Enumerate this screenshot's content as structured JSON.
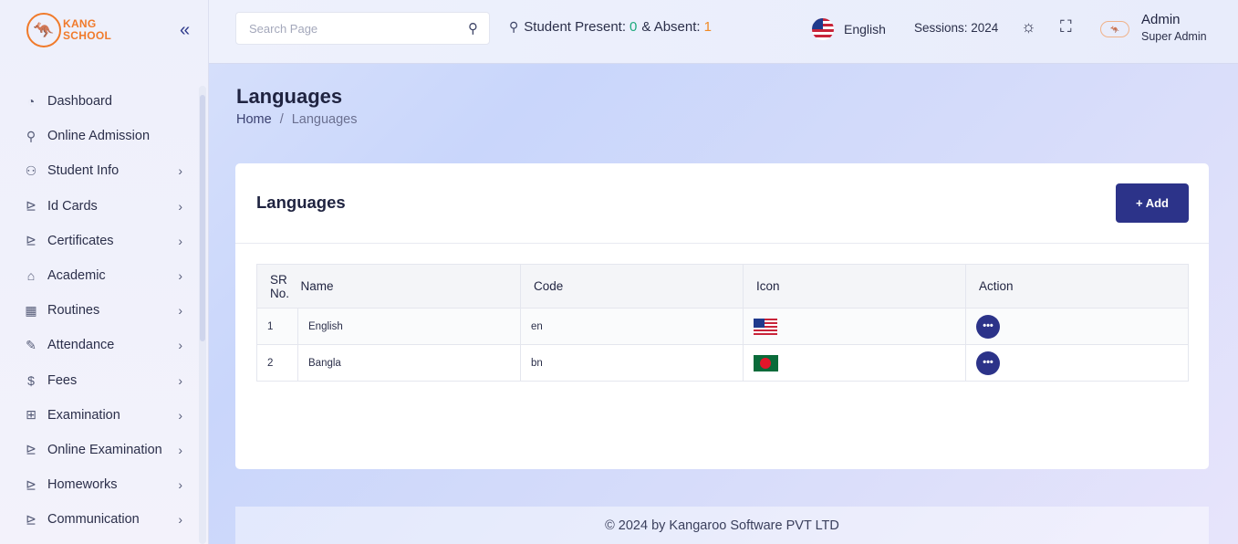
{
  "brand": {
    "logo_line1": "KANG",
    "logo_line2": "SCHOOL"
  },
  "sidebar": {
    "collapse_icon": "double-chevron-left-icon",
    "items": [
      {
        "label": "Dashboard",
        "icon": "gauge-icon",
        "has_children": false
      },
      {
        "label": "Online Admission",
        "icon": "user-icon",
        "has_children": false
      },
      {
        "label": "Student Info",
        "icon": "users-icon",
        "has_children": true
      },
      {
        "label": "Id Cards",
        "icon": "chart-icon",
        "has_children": true
      },
      {
        "label": "Certificates",
        "icon": "chart-icon",
        "has_children": true
      },
      {
        "label": "Academic",
        "icon": "graduation-cap-icon",
        "has_children": true
      },
      {
        "label": "Routines",
        "icon": "calendar-icon",
        "has_children": true
      },
      {
        "label": "Attendance",
        "icon": "pen-icon",
        "has_children": true
      },
      {
        "label": "Fees",
        "icon": "money-hand-icon",
        "has_children": true
      },
      {
        "label": "Examination",
        "icon": "gift-icon",
        "has_children": true
      },
      {
        "label": "Online Examination",
        "icon": "chart-icon",
        "has_children": true
      },
      {
        "label": "Homeworks",
        "icon": "chart-icon",
        "has_children": true
      },
      {
        "label": "Communication",
        "icon": "chart-icon",
        "has_children": true
      }
    ]
  },
  "header": {
    "search_placeholder": "Search Page",
    "presence_prefix": "Student Present:",
    "present_count": "0",
    "presence_joiner": "& Absent:",
    "absent_count": "1",
    "language": "English",
    "sessions": "Sessions: 2024",
    "admin_name": "Admin",
    "admin_role": "Super Admin",
    "colors": {
      "present": "#1ea97c",
      "absent": "#f08a24",
      "accent": "#2c3389"
    }
  },
  "page": {
    "title": "Languages",
    "breadcrumb_home": "Home",
    "breadcrumb_sep": "/",
    "breadcrumb_current": "Languages"
  },
  "card": {
    "title": "Languages",
    "add_label": "+ Add",
    "columns": [
      "SR No.",
      "Name",
      "Code",
      "Icon",
      "Action"
    ],
    "rows": [
      {
        "sr": "1",
        "name": "English",
        "code": "en",
        "icon": "us-flag-icon",
        "action": "•••"
      },
      {
        "sr": "2",
        "name": "Bangla",
        "code": "bn",
        "icon": "bangladesh-flag-icon",
        "action": "•••"
      }
    ]
  },
  "footer": {
    "text": "© 2024 by Kangaroo Software PVT LTD"
  }
}
